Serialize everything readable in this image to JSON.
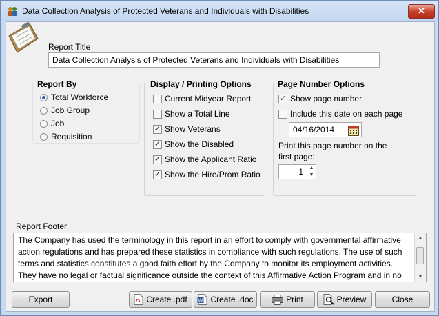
{
  "window": {
    "title": "Data Collection Analysis of Protected Veterans and Individuals with Disabilities",
    "close_label": "✕"
  },
  "report_title": {
    "label": "Report Title",
    "value": "Data Collection Analysis of Protected Veterans and Individuals with Disabilities"
  },
  "report_by": {
    "heading": "Report By",
    "options": [
      {
        "label": "Total Workforce",
        "selected": true
      },
      {
        "label": "Job Group",
        "selected": false
      },
      {
        "label": "Job",
        "selected": false
      },
      {
        "label": "Requisition",
        "selected": false
      }
    ]
  },
  "display_options": {
    "heading": "Display / Printing Options",
    "options": [
      {
        "label": "Current Midyear Report",
        "checked": false
      },
      {
        "label": "Show a Total Line",
        "checked": false
      },
      {
        "label": "Show Veterans",
        "checked": true
      },
      {
        "label": "Show the Disabled",
        "checked": true
      },
      {
        "label": "Show the Applicant Ratio",
        "checked": true
      },
      {
        "label": "Show the Hire/Prom Ratio",
        "checked": true
      }
    ]
  },
  "page_number": {
    "heading": "Page Number Options",
    "show_page_number": {
      "label": "Show page number",
      "checked": true
    },
    "include_date": {
      "label": "Include this date on each page",
      "checked": false
    },
    "date_value": "04/16/2014",
    "first_page_label_line1": "Print this page number on the",
    "first_page_label_line2": "first page:",
    "first_page_value": "1"
  },
  "footer": {
    "label": "Report Footer",
    "text": "The Company has used the terminology in this report in an effort to comply with governmental affirmative action regulations and has prepared these statistics in compliance with such regulations. The use of such terms and statistics constitutes a good faith effort by the Company to monitor its employment activities. They have no legal or factual significance outside the context of this Affirmative Action Program and in no way suggest any wrong doing by the Company."
  },
  "buttons": {
    "export": "Export",
    "create_pdf": "Create .pdf",
    "create_doc": "Create .doc",
    "print": "Print",
    "preview": "Preview",
    "close": "Close"
  }
}
